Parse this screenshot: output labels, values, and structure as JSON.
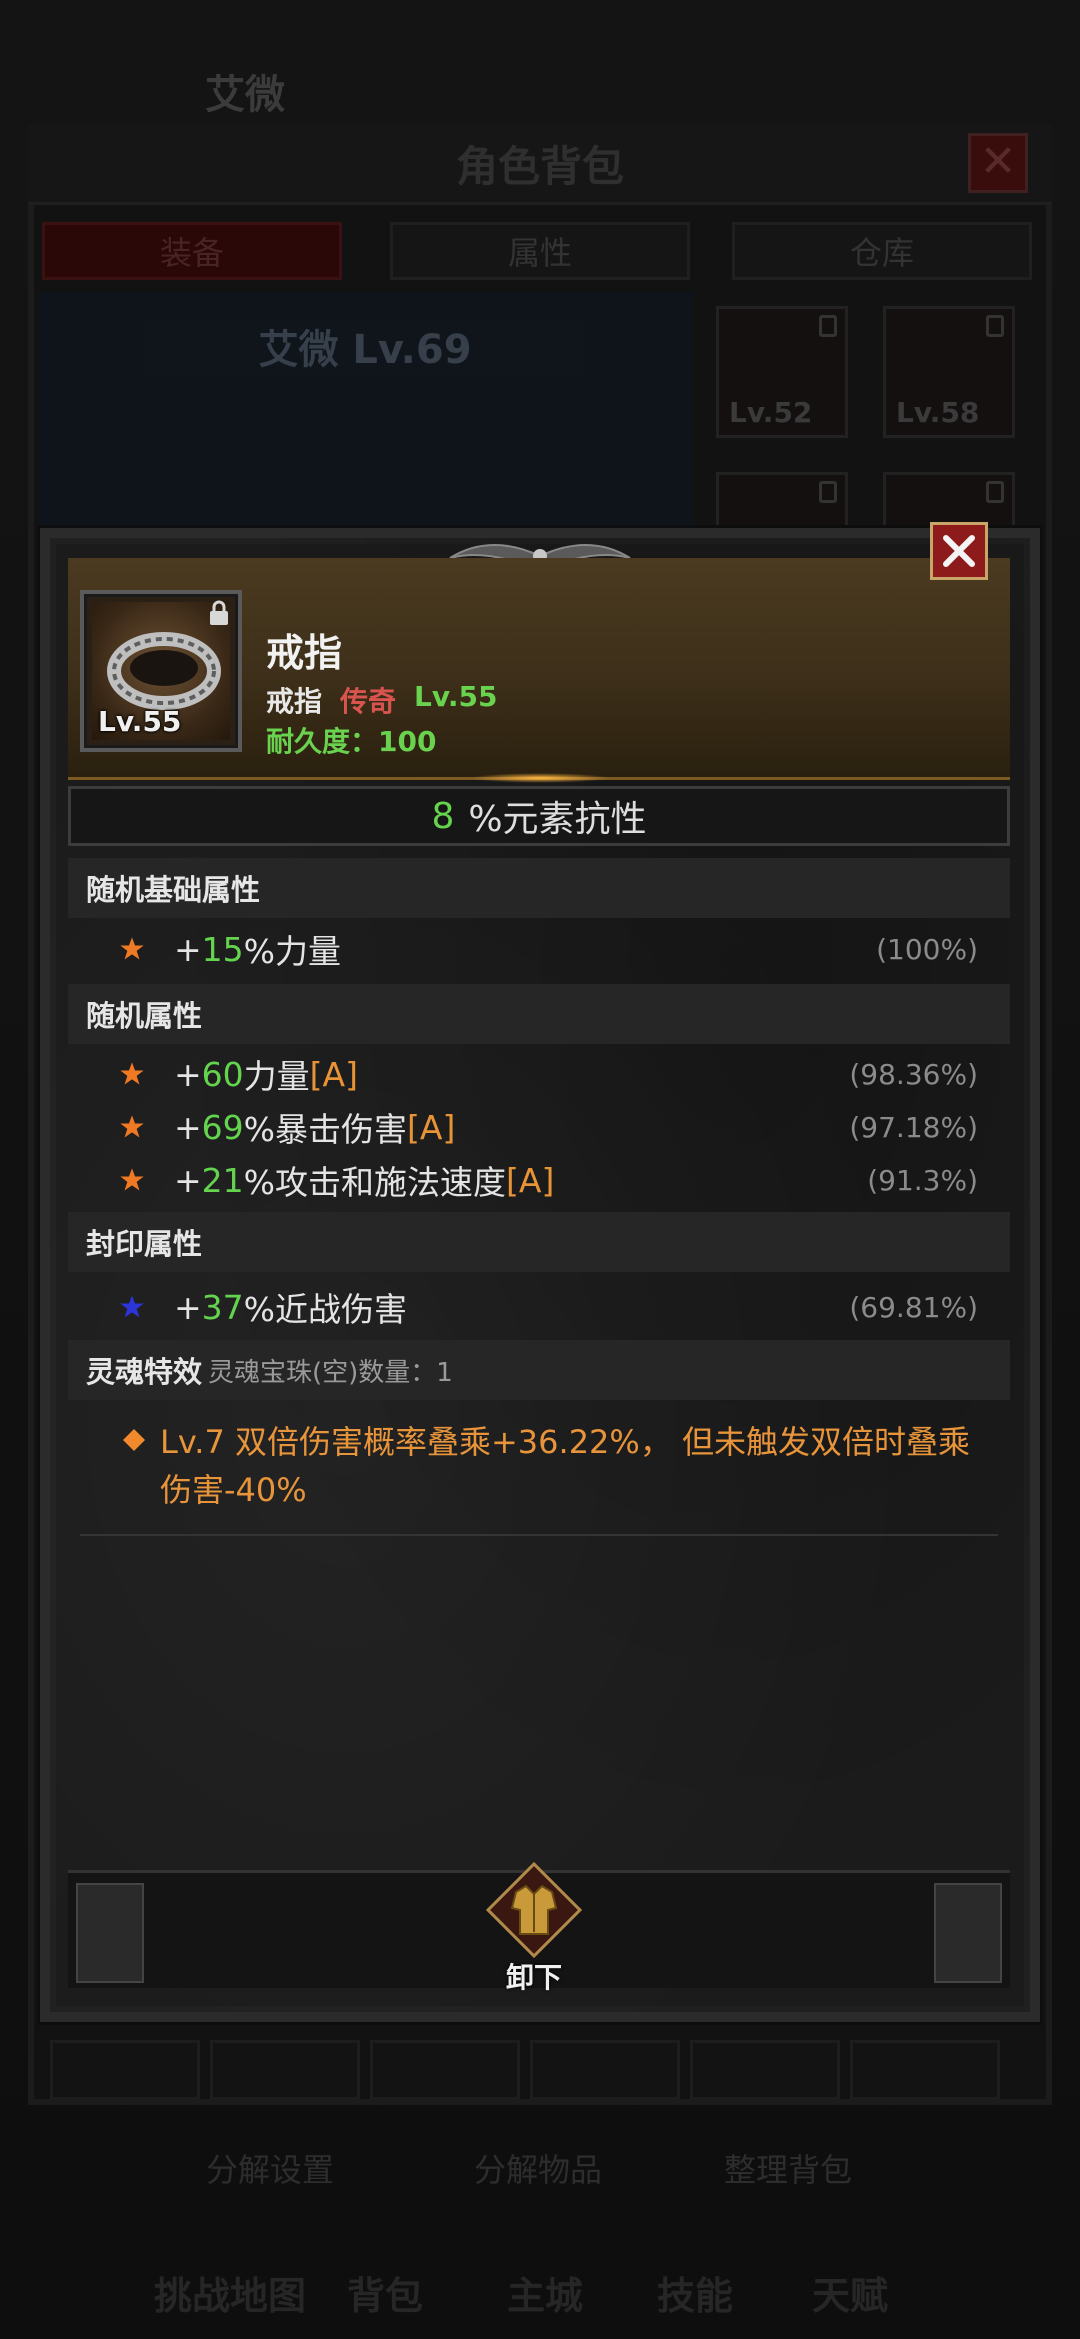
{
  "background": {
    "player_name": "艾微",
    "window_title": "角色背包",
    "tabs": [
      "装备",
      "属性",
      "仓库"
    ],
    "character_label": "艾微 Lv.69",
    "slot_levels": [
      "Lv.52",
      "Lv.58"
    ],
    "bottom_buttons": [
      "分解设置",
      "分解物品",
      "整理背包"
    ],
    "nav_items": [
      "挑战地图",
      "背包",
      "主城",
      "技能",
      "天赋"
    ]
  },
  "item": {
    "name": "戒指",
    "type": "戒指",
    "rarity": "传奇",
    "level": "Lv.55",
    "icon_level": "Lv.55",
    "durability": "耐久度：100",
    "rarity_color": "#d9534f"
  },
  "main_stat": {
    "value": "8",
    "label": "%元素抗性"
  },
  "sections": {
    "random_base": {
      "title": "随机基础属性",
      "rows": [
        {
          "prefix": "+",
          "value": "15",
          "text": "%力量",
          "tag": "",
          "pct": "(100%)"
        }
      ]
    },
    "random": {
      "title": "随机属性",
      "rows": [
        {
          "prefix": "+",
          "value": "60",
          "text": "力量",
          "tag": "[A]",
          "pct": "(98.36%)"
        },
        {
          "prefix": "+",
          "value": "69",
          "text": "%暴击伤害",
          "tag": "[A]",
          "pct": "(97.18%)"
        },
        {
          "prefix": "+",
          "value": "21",
          "text": "%攻击和施法速度",
          "tag": "[A]",
          "pct": "(91.3%)"
        }
      ]
    },
    "sealed": {
      "title": "封印属性",
      "rows": [
        {
          "prefix": "+",
          "value": "37",
          "text": "%近战伤害",
          "tag": "",
          "pct": "(69.81%)"
        }
      ]
    },
    "soul": {
      "title": "灵魂特效",
      "subtitle": "灵魂宝珠(空)数量：1",
      "effect": "Lv.7 双倍伤害概率叠乘+36.22%， 但未触发双倍时叠乘伤害-40%"
    }
  },
  "footer": {
    "unequip_label": "卸下"
  }
}
